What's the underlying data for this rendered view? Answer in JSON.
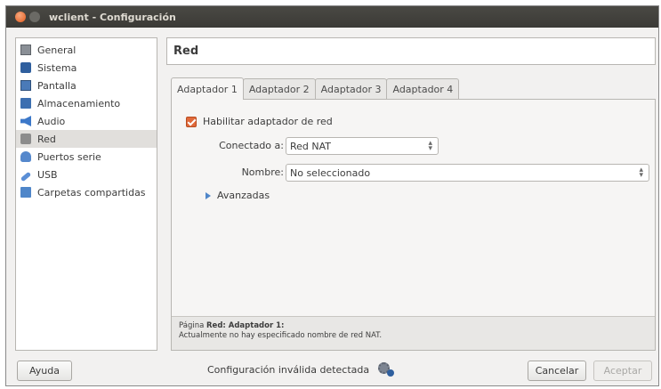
{
  "window": {
    "title": "wclient - Configuración"
  },
  "sidebar": {
    "items": [
      {
        "label": "General",
        "icon": "general-icon"
      },
      {
        "label": "Sistema",
        "icon": "system-chip-icon"
      },
      {
        "label": "Pantalla",
        "icon": "display-icon"
      },
      {
        "label": "Almacenamiento",
        "icon": "storage-icon"
      },
      {
        "label": "Audio",
        "icon": "speaker-icon"
      },
      {
        "label": "Red",
        "icon": "network-icon",
        "selected": true
      },
      {
        "label": "Puertos serie",
        "icon": "serial-port-icon"
      },
      {
        "label": "USB",
        "icon": "usb-icon"
      },
      {
        "label": "Carpetas compartidas",
        "icon": "folder-icon"
      }
    ]
  },
  "page": {
    "title": "Red"
  },
  "tabs": [
    {
      "label": "Adaptador 1",
      "active": true
    },
    {
      "label": "Adaptador 2"
    },
    {
      "label": "Adaptador 3"
    },
    {
      "label": "Adaptador 4"
    }
  ],
  "adapter": {
    "enable_label": "Habilitar adaptador de red",
    "enabled": true,
    "attached_label": "Conectado a:",
    "attached_value": "Red NAT",
    "name_label": "Nombre:",
    "name_value": "No seleccionado",
    "advanced_label": "Avanzadas"
  },
  "info": {
    "prefix": "Página ",
    "bold": "Red: Adaptador 1:",
    "message": "Actualmente no hay especificado nombre de red NAT."
  },
  "footer": {
    "help_label": "Ayuda",
    "status_text": "Configuración inválida detectada",
    "cancel_label": "Cancelar",
    "accept_label": "Aceptar"
  },
  "colors": {
    "accent": "#e0693a",
    "selection": "#e1dfdc",
    "titlebar": "#3b3a36"
  }
}
